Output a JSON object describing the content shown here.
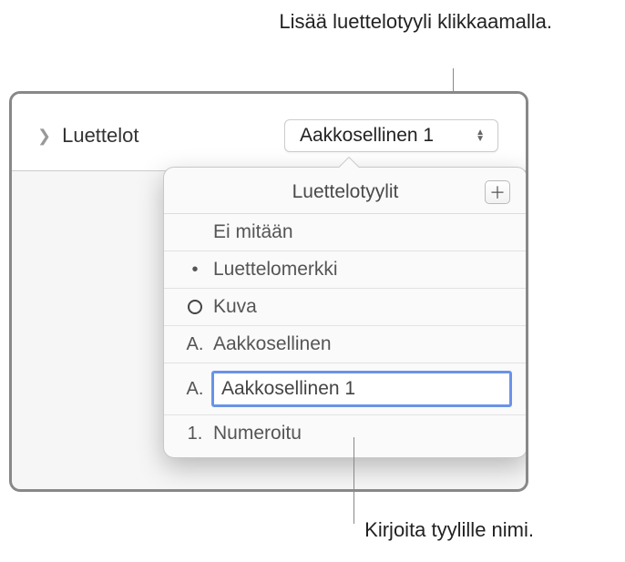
{
  "annotations": {
    "top": "Lisää luettelotyyli klikkaamalla.",
    "bottom": "Kirjoita tyylille nimi."
  },
  "inspector": {
    "row_label": "Luettelot",
    "selected_style": "Aakkosellinen 1"
  },
  "popover": {
    "title": "Luettelotyylit",
    "styles": {
      "none": "Ei mitään",
      "bullet": "Luettelomerkki",
      "image": "Kuva",
      "lettered": "Aakkosellinen",
      "lettered_1_marker": "A.",
      "lettered_marker": "A.",
      "numbered_marker": "1.",
      "numbered": "Numeroitu",
      "editing_value": "Aakkosellinen 1"
    }
  }
}
